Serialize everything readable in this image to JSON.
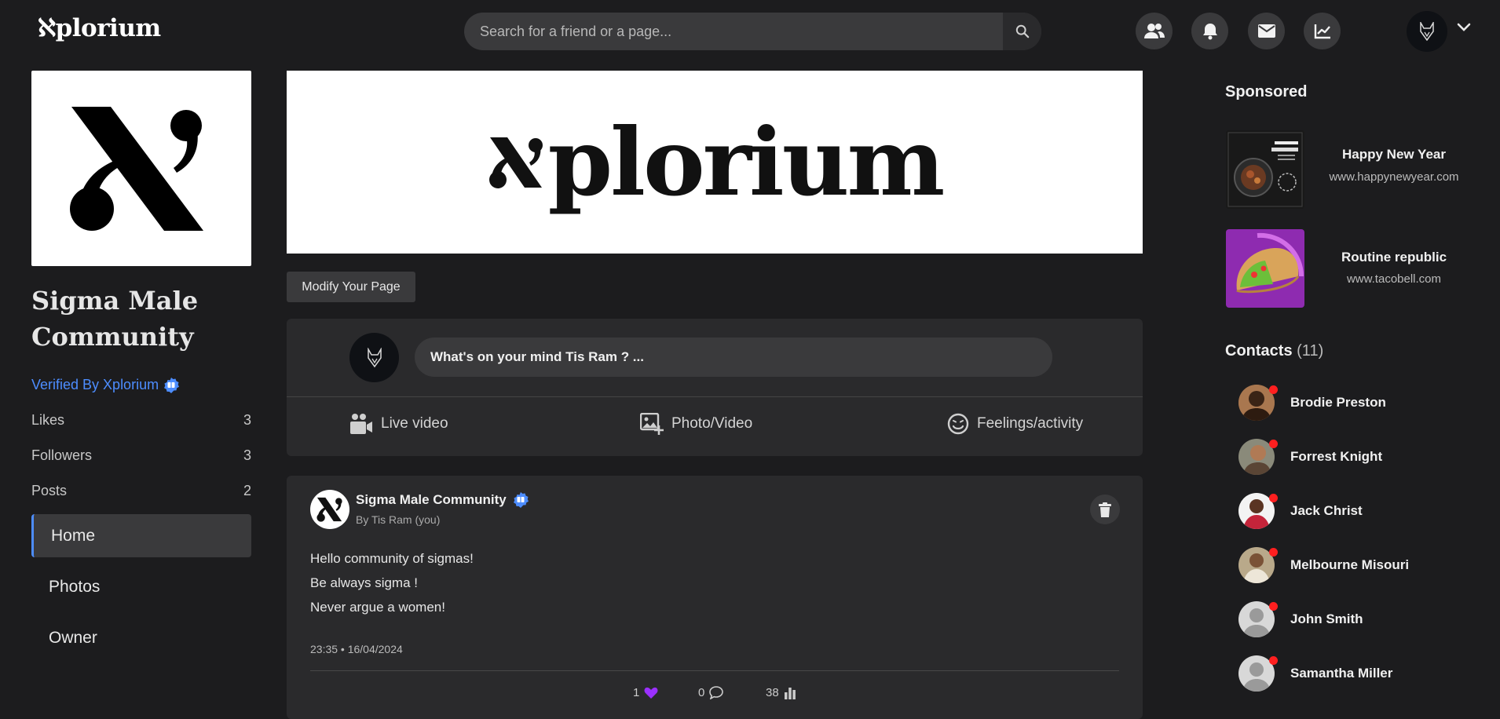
{
  "header": {
    "logo": "ℵplorium",
    "search_placeholder": "Search for a friend or a page...",
    "nav_icons": [
      "friends-icon",
      "bell-icon",
      "mail-icon",
      "chart-icon"
    ]
  },
  "page": {
    "name": "Sigma Male Community",
    "verified_text": "Verified By Xplorium",
    "stats": [
      {
        "label": "Likes",
        "value": "3"
      },
      {
        "label": "Followers",
        "value": "3"
      },
      {
        "label": "Posts",
        "value": "2"
      }
    ],
    "menu": [
      {
        "label": "Home",
        "active": true
      },
      {
        "label": "Photos",
        "active": false
      },
      {
        "label": "Owner",
        "active": false
      }
    ]
  },
  "banner": {
    "text": "plorium"
  },
  "modify_button": "Modify Your Page",
  "composer": {
    "prompt": "What's on your mind Tis Ram ? ...",
    "actions": [
      "Live video",
      "Photo/Video",
      "Feelings/activity"
    ]
  },
  "post": {
    "author": "Sigma Male Community",
    "by": "By Tis Ram (you)",
    "lines": [
      "Hello community of sigmas!",
      "Be always sigma !",
      "Never argue a women!"
    ],
    "timestamp": "23:35 • 16/04/2024",
    "likes": "1",
    "comments": "0",
    "views": "38"
  },
  "sponsored": {
    "title": "Sponsored",
    "ads": [
      {
        "title": "Happy New Year",
        "url": "www.happynewyear.com"
      },
      {
        "title": "Routine republic",
        "url": "www.tacobell.com"
      }
    ]
  },
  "contacts": {
    "title": "Contacts",
    "count": "(11)",
    "list": [
      {
        "name": "Brodie Preston"
      },
      {
        "name": "Forrest Knight"
      },
      {
        "name": "Jack Christ"
      },
      {
        "name": "Melbourne Misouri"
      },
      {
        "name": "John Smith"
      },
      {
        "name": "Samantha Miller"
      }
    ]
  },
  "colors": {
    "accent": "#4d8dff",
    "like": "#9b30ff",
    "online_dot": "#ff1f1f",
    "background": "#1c1c1e",
    "card": "#2a2a2c"
  }
}
